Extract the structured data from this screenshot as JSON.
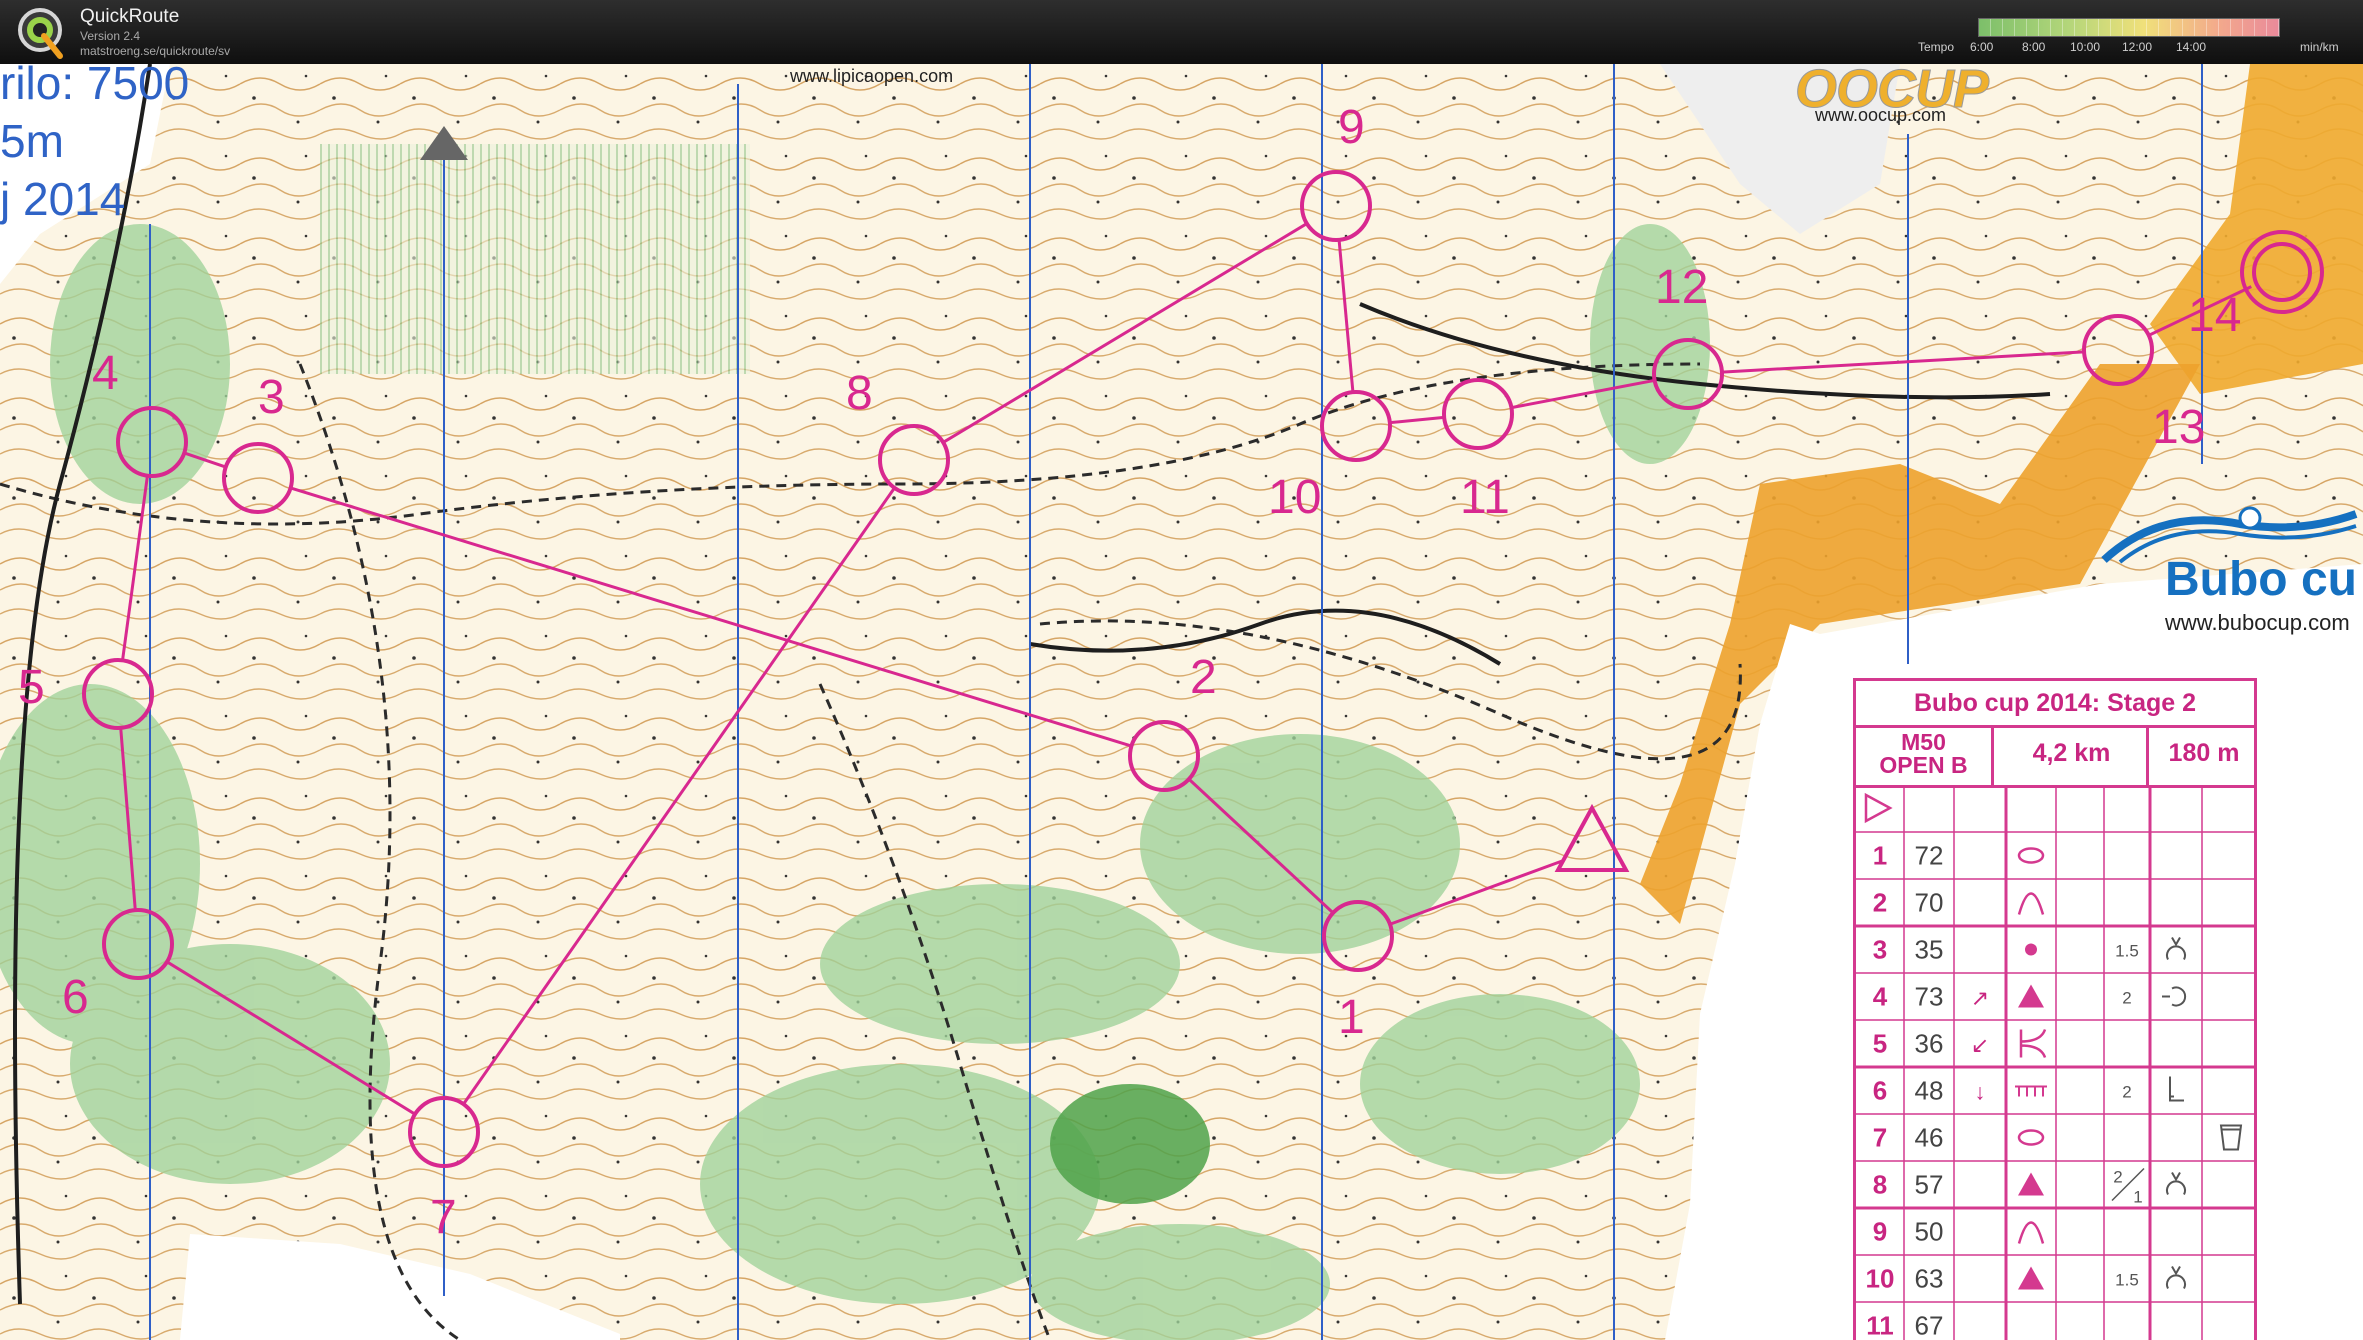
{
  "app": {
    "name": "QuickRoute",
    "version": "Version 2.4",
    "url": "matstroeng.se/quickroute/sv"
  },
  "tempo_legend": {
    "label": "Tempo",
    "ticks": [
      "6:00",
      "8:00",
      "10:00",
      "12:00",
      "14:00"
    ],
    "unit": "min/km"
  },
  "map": {
    "event_text": [
      "rilo: 7500",
      "5m",
      "j 2014"
    ],
    "sponsors": {
      "lipica_url": "www.lipicaopen.com",
      "oocup_logo": "OOCUP",
      "oocup_url": "www.oocup.com",
      "bubo_logo": "Bubo cu",
      "bubo_url": "www.bubocup.com"
    },
    "course_color": "#d8288f",
    "controls": [
      {
        "label": "1"
      },
      {
        "label": "2"
      },
      {
        "label": "3"
      },
      {
        "label": "4"
      },
      {
        "label": "5"
      },
      {
        "label": "6"
      },
      {
        "label": "7"
      },
      {
        "label": "8"
      },
      {
        "label": "9"
      },
      {
        "label": "10"
      },
      {
        "label": "11"
      },
      {
        "label": "12"
      },
      {
        "label": "13"
      },
      {
        "label": "14"
      }
    ]
  },
  "control_card": {
    "title": "Bubo cup 2014: Stage 2",
    "class_line1": "M50",
    "class_line2": "OPEN B",
    "length": "4,2 km",
    "climb": "180 m",
    "rows": [
      {
        "n": "1",
        "code": "72",
        "dir": "",
        "feature": "mound",
        "dim": "",
        "detail": ""
      },
      {
        "n": "2",
        "code": "70",
        "dir": "",
        "feature": "knoll",
        "dim": "",
        "detail": ""
      },
      {
        "n": "3",
        "code": "35",
        "dir": "",
        "feature": "dot",
        "dim": "1.5",
        "detail": "foot"
      },
      {
        "n": "4",
        "code": "73",
        "dir": "↗",
        "feature": "boulder",
        "dim": "2",
        "detail": "side"
      },
      {
        "n": "5",
        "code": "36",
        "dir": "↙",
        "feature": "junction",
        "dim": "",
        "detail": ""
      },
      {
        "n": "6",
        "code": "48",
        "dir": "↓",
        "feature": "wall",
        "dim": "2",
        "detail": "corner"
      },
      {
        "n": "7",
        "code": "46",
        "dir": "",
        "feature": "mound",
        "dim": "",
        "detail": "water"
      },
      {
        "n": "8",
        "code": "57",
        "dir": "",
        "feature": "boulder",
        "dim": "2/1",
        "detail": "foot"
      },
      {
        "n": "9",
        "code": "50",
        "dir": "",
        "feature": "knoll",
        "dim": "",
        "detail": ""
      },
      {
        "n": "10",
        "code": "63",
        "dir": "",
        "feature": "boulder",
        "dim": "1.5",
        "detail": "foot"
      },
      {
        "n": "11",
        "code": "67",
        "dir": "",
        "feature": "",
        "dim": "",
        "detail": ""
      }
    ]
  }
}
